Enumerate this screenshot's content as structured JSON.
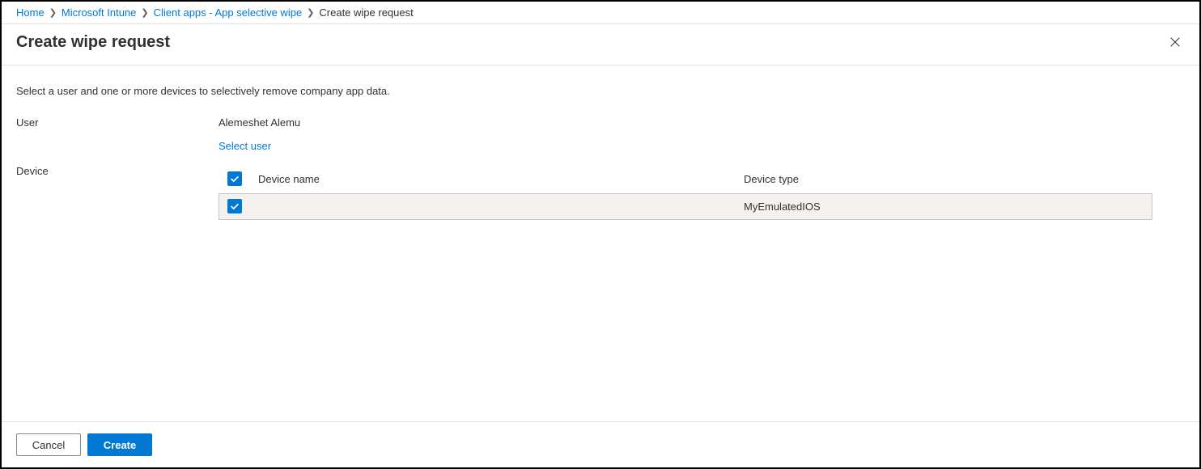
{
  "breadcrumb": {
    "items": [
      {
        "label": "Home",
        "link": true
      },
      {
        "label": "Microsoft Intune",
        "link": true
      },
      {
        "label": "Client apps - App selective wipe",
        "link": true
      },
      {
        "label": "Create wipe request",
        "link": false
      }
    ]
  },
  "title": "Create wipe request",
  "instruction": "Select a user and one or more devices to selectively remove company app data.",
  "user": {
    "label": "User",
    "value": "Alemeshet Alemu",
    "select_link": "Select user"
  },
  "device": {
    "label": "Device",
    "columns": {
      "name": "Device name",
      "type": "Device type"
    },
    "rows": [
      {
        "name": "",
        "type": "MyEmulatedIOS",
        "checked": true
      }
    ]
  },
  "footer": {
    "cancel": "Cancel",
    "create": "Create"
  }
}
